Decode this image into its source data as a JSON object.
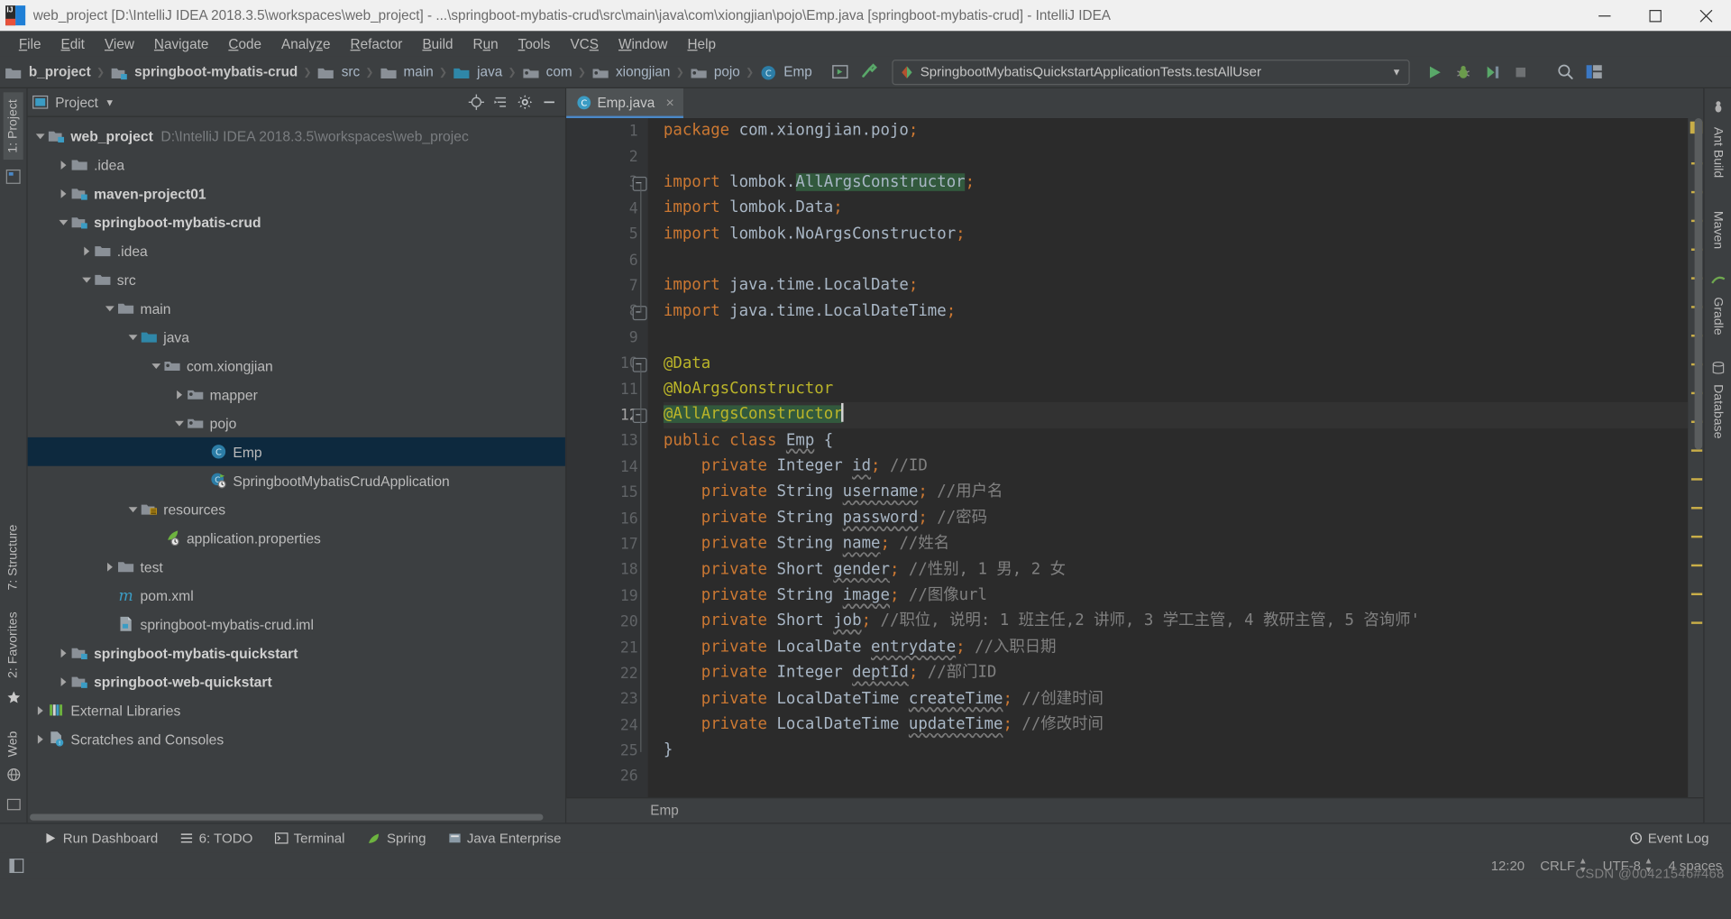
{
  "window": {
    "title": "web_project [D:\\IntelliJ IDEA 2018.3.5\\workspaces\\web_project] - ...\\springboot-mybatis-crud\\src\\main\\java\\com\\xiongjian\\pojo\\Emp.java [springboot-mybatis-crud] - IntelliJ IDEA",
    "minimize_label": "Minimize",
    "maximize_label": "Maximize",
    "close_label": "Close"
  },
  "menubar": {
    "items": [
      "File",
      "Edit",
      "View",
      "Navigate",
      "Code",
      "Analyze",
      "Refactor",
      "Build",
      "Run",
      "Tools",
      "VCS",
      "Window",
      "Help"
    ]
  },
  "navbar": {
    "crumbs": [
      {
        "label": "b_project",
        "icon": "project-icon",
        "bold": true
      },
      {
        "label": "springboot-mybatis-crud",
        "icon": "module-folder-icon",
        "bold": true
      },
      {
        "label": "src",
        "icon": "folder-icon",
        "bold": false
      },
      {
        "label": "main",
        "icon": "folder-icon",
        "bold": false
      },
      {
        "label": "java",
        "icon": "source-folder-icon",
        "bold": false
      },
      {
        "label": "com",
        "icon": "package-icon",
        "bold": false
      },
      {
        "label": "xiongjian",
        "icon": "package-icon",
        "bold": false
      },
      {
        "label": "pojo",
        "icon": "package-icon",
        "bold": false
      },
      {
        "label": "Emp",
        "icon": "class-icon",
        "bold": false
      }
    ],
    "run_config": "SpringbootMybatisQuickstartApplicationTests.testAllUser",
    "icons": [
      "run-config-edit-icon",
      "build-hammer-icon",
      "run-icon",
      "debug-icon",
      "coverage-icon",
      "stop-icon",
      "search-everywhere-icon",
      "layout-icon"
    ]
  },
  "left_strip": {
    "top_tab": "1: Project",
    "bottom_tabs": [
      "2: Favorites",
      "7: Structure"
    ],
    "web_tab": "Web"
  },
  "right_strip": {
    "tabs": [
      "Ant Build",
      "Maven",
      "Gradle",
      "Database"
    ]
  },
  "project_panel": {
    "title": "Project",
    "header_icons": [
      "locate-icon",
      "collapse-all-icon",
      "settings-gear-icon",
      "hide-icon"
    ],
    "tree": [
      {
        "indent": 0,
        "twist": "down",
        "icon": "project-root-icon",
        "label": "web_project",
        "bold": true,
        "sub": "D:\\IntelliJ IDEA 2018.3.5\\workspaces\\web_projec"
      },
      {
        "indent": 1,
        "twist": "right",
        "icon": "folder-icon",
        "label": ".idea",
        "bold": false,
        "sub": ""
      },
      {
        "indent": 1,
        "twist": "right",
        "icon": "module-folder-icon",
        "label": "maven-project01",
        "bold": true,
        "sub": ""
      },
      {
        "indent": 1,
        "twist": "down",
        "icon": "module-folder-icon",
        "label": "springboot-mybatis-crud",
        "bold": true,
        "sub": ""
      },
      {
        "indent": 2,
        "twist": "right",
        "icon": "folder-icon",
        "label": ".idea",
        "bold": false,
        "sub": ""
      },
      {
        "indent": 2,
        "twist": "down",
        "icon": "folder-icon",
        "label": "src",
        "bold": false,
        "sub": ""
      },
      {
        "indent": 3,
        "twist": "down",
        "icon": "folder-icon",
        "label": "main",
        "bold": false,
        "sub": ""
      },
      {
        "indent": 4,
        "twist": "down",
        "icon": "source-folder-icon",
        "label": "java",
        "bold": false,
        "sub": ""
      },
      {
        "indent": 5,
        "twist": "down",
        "icon": "package-icon",
        "label": "com.xiongjian",
        "bold": false,
        "sub": ""
      },
      {
        "indent": 6,
        "twist": "right",
        "icon": "package-icon",
        "label": "mapper",
        "bold": false,
        "sub": ""
      },
      {
        "indent": 6,
        "twist": "down",
        "icon": "package-icon",
        "label": "pojo",
        "bold": false,
        "sub": ""
      },
      {
        "indent": 7,
        "twist": "none",
        "icon": "class-icon",
        "label": "Emp",
        "bold": false,
        "sub": "",
        "selected": true
      },
      {
        "indent": 7,
        "twist": "none",
        "icon": "spring-class-icon",
        "label": "SpringbootMybatisCrudApplication",
        "bold": false,
        "sub": ""
      },
      {
        "indent": 4,
        "twist": "down",
        "icon": "resources-folder-icon",
        "label": "resources",
        "bold": false,
        "sub": ""
      },
      {
        "indent": 5,
        "twist": "none",
        "icon": "spring-properties-icon",
        "label": "application.properties",
        "bold": false,
        "sub": ""
      },
      {
        "indent": 3,
        "twist": "right",
        "icon": "folder-icon",
        "label": "test",
        "bold": false,
        "sub": ""
      },
      {
        "indent": 3,
        "twist": "none",
        "icon": "maven-pom-icon",
        "label": "pom.xml",
        "bold": false,
        "sub": ""
      },
      {
        "indent": 3,
        "twist": "none",
        "icon": "iml-icon",
        "label": "springboot-mybatis-crud.iml",
        "bold": false,
        "sub": ""
      },
      {
        "indent": 1,
        "twist": "right",
        "icon": "module-folder-icon",
        "label": "springboot-mybatis-quickstart",
        "bold": true,
        "sub": ""
      },
      {
        "indent": 1,
        "twist": "right",
        "icon": "module-folder-icon",
        "label": "springboot-web-quickstart",
        "bold": true,
        "sub": ""
      },
      {
        "indent": 0,
        "twist": "right",
        "icon": "external-libraries-icon",
        "label": "External Libraries",
        "bold": false,
        "sub": ""
      },
      {
        "indent": 0,
        "twist": "right",
        "icon": "scratches-icon",
        "label": "Scratches and Consoles",
        "bold": false,
        "sub": ""
      }
    ]
  },
  "editor": {
    "tab": {
      "label": "Emp.java",
      "icon": "java-class-icon",
      "close": "×"
    },
    "breadcrumb": "Emp",
    "first_line": 1,
    "line_count": 26,
    "lines": [
      {
        "n": 1,
        "html": "<span class=\"kw\">package</span> com.xiongjian.pojo<span class=\"kw\">;</span>"
      },
      {
        "n": 2,
        "html": ""
      },
      {
        "n": 3,
        "html": "<span class=\"kw\">import</span> lombok.<span class=\"hl\">AllArgsConstructor</span><span class=\"kw\">;</span>"
      },
      {
        "n": 4,
        "html": "<span class=\"kw\">import</span> lombok.Data<span class=\"kw\">;</span>"
      },
      {
        "n": 5,
        "html": "<span class=\"kw\">import</span> lombok.NoArgsConstructor<span class=\"kw\">;</span>"
      },
      {
        "n": 6,
        "html": ""
      },
      {
        "n": 7,
        "html": "<span class=\"kw\">import</span> java.time.LocalDate<span class=\"kw\">;</span>"
      },
      {
        "n": 8,
        "html": "<span class=\"kw\">import</span> java.time.LocalDateTime<span class=\"kw\">;</span>"
      },
      {
        "n": 9,
        "html": ""
      },
      {
        "n": 10,
        "html": "<span class=\"ann\">@Data</span>"
      },
      {
        "n": 11,
        "html": "<span class=\"ann\">@NoArgsConstructor</span>"
      },
      {
        "n": 12,
        "html": "<span class=\"ann hl\">@AllArgsConstructor</span><span class=\"caret\"></span>"
      },
      {
        "n": 13,
        "html": "<span class=\"kw\">public class</span> <span class=\"wavy\">Emp</span> {"
      },
      {
        "n": 14,
        "html": "    <span class=\"kw\">private</span> Integer <span class=\"wavy\">id</span><span class=\"kw\">;</span> <span class=\"cm\">//ID</span>"
      },
      {
        "n": 15,
        "html": "    <span class=\"kw\">private</span> String <span class=\"wavy\">username</span><span class=\"kw\">;</span> <span class=\"cm\">//用户名</span>"
      },
      {
        "n": 16,
        "html": "    <span class=\"kw\">private</span> String <span class=\"wavy\">password</span><span class=\"kw\">;</span> <span class=\"cm\">//密码</span>"
      },
      {
        "n": 17,
        "html": "    <span class=\"kw\">private</span> String <span class=\"wavy\">name</span><span class=\"kw\">;</span> <span class=\"cm\">//姓名</span>"
      },
      {
        "n": 18,
        "html": "    <span class=\"kw\">private</span> Short <span class=\"wavy\">gender</span><span class=\"kw\">;</span> <span class=\"cm\">//性别, 1 男, 2 女</span>"
      },
      {
        "n": 19,
        "html": "    <span class=\"kw\">private</span> String <span class=\"wavy\">image</span><span class=\"kw\">;</span> <span class=\"cm\">//图像url</span>"
      },
      {
        "n": 20,
        "html": "    <span class=\"kw\">private</span> Short <span class=\"wavy\">job</span><span class=\"kw\">;</span> <span class=\"cm\">//职位, 说明: 1 班主任,2 讲师, 3 学工主管, 4 教研主管, 5 咨询师'</span>"
      },
      {
        "n": 21,
        "html": "    <span class=\"kw\">private</span> LocalDate <span class=\"wavy\">entrydate</span><span class=\"kw\">;</span> <span class=\"cm\">//入职日期</span>"
      },
      {
        "n": 22,
        "html": "    <span class=\"kw\">private</span> Integer <span class=\"wavy\">deptId</span><span class=\"kw\">;</span> <span class=\"cm\">//部门ID</span>"
      },
      {
        "n": 23,
        "html": "    <span class=\"kw\">private</span> LocalDateTime <span class=\"wavy\">createTime</span><span class=\"kw\">;</span> <span class=\"cm\">//创建时间</span>"
      },
      {
        "n": 24,
        "html": "    <span class=\"kw\">private</span> LocalDateTime <span class=\"wavy\">updateTime</span><span class=\"kw\">;</span> <span class=\"cm\">//修改时间</span>"
      },
      {
        "n": 25,
        "html": "}"
      },
      {
        "n": 26,
        "html": ""
      }
    ],
    "current_line": 12
  },
  "bottom_bar": {
    "items": [
      {
        "label": "Run Dashboard",
        "icon": "run-icon",
        "prefix": ""
      },
      {
        "label": "6: TODO",
        "icon": "todo-icon",
        "prefix": ""
      },
      {
        "label": "Terminal",
        "icon": "terminal-icon",
        "prefix": ""
      },
      {
        "label": "Spring",
        "icon": "spring-leaf-icon",
        "prefix": ""
      },
      {
        "label": "Java Enterprise",
        "icon": "java-enterprise-icon",
        "prefix": ""
      }
    ],
    "event_log": "Event Log"
  },
  "status_bar": {
    "caret_position": "12:20",
    "line_separator": "CRLF",
    "encoding": "UTF-8",
    "indent": "4 spaces",
    "watermark": "CSDN @00421546#468"
  },
  "colors": {
    "accent": "#4a88c7",
    "panel_bg": "#3c3f41",
    "editor_bg": "#2b2b2b",
    "gutter_bg": "#313335",
    "selection_bg": "#0d293e",
    "keyword": "#cc7832",
    "annotation": "#bbb529",
    "comment": "#808080",
    "highlight": "#32593d",
    "text": "#a9b7c6"
  }
}
